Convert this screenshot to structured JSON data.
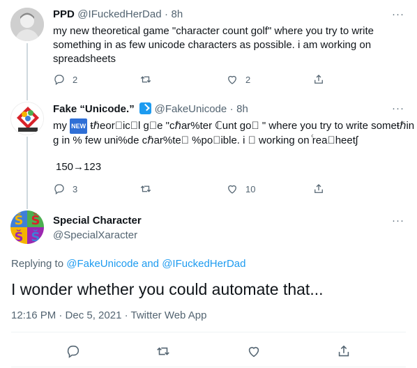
{
  "tweet1": {
    "name": "PPD",
    "handle": "@IFuckedHerDad",
    "time": "8h",
    "text": "my new theoretical game \"character count golf\" where you try to write something in as few unicode characters as possible. i am working on spreadsheets",
    "replies": "2",
    "retweets": "",
    "likes": "2"
  },
  "tweet2": {
    "name": "Fake “Unicode.”",
    "handle": "@FakeUnicode",
    "time": "8h",
    "badge": "NEW",
    "text_line1": "my ",
    "text_line1b": " ŧℏeor⃞icⓐl g⃞e \"cℏar%ter ℂunt go⸃ \" where you try to write someŧℏin",
    "text_line2": "g in % few uni%de cℏar%te⸃ %po⃞ible. i ⃞ working on ⷭrea⃞heetʃ",
    "count": "150→123",
    "replies": "3",
    "retweets": "",
    "likes": "10"
  },
  "tweet3": {
    "name": "Special Character",
    "handle": "@SpecialXaracter",
    "avatar_glyphs": [
      "Š",
      "Š",
      "Š",
      "Š"
    ],
    "replying_prefix": "Replying to ",
    "replying_to1": "@FakeUnicode",
    "replying_and": " and ",
    "replying_to2": "@IFuckedHerDad",
    "text": "I wonder whether you could automate that...",
    "meta": "12:16 PM · Dec 5, 2021 · Twitter Web App"
  },
  "more_label": "···",
  "colors": {
    "accent": "#1d9bf0",
    "muted": "#536471",
    "line": "#cfd9de"
  }
}
